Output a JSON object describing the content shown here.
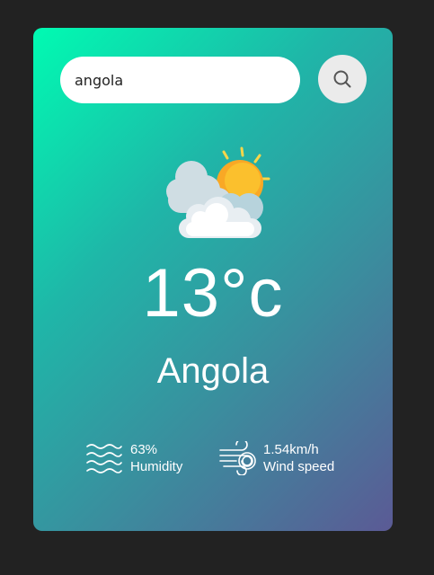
{
  "search": {
    "value": "angola",
    "placeholder": "",
    "button_icon": "search-icon"
  },
  "weather": {
    "icon": "partly-cloudy-icon",
    "temperature": "13°c",
    "city": "Angola"
  },
  "details": {
    "humidity": {
      "icon": "humidity-waves-icon",
      "value": "63%",
      "label": "Humidity"
    },
    "wind": {
      "icon": "wind-icon",
      "value": "1.54km/h",
      "label": "Wind speed"
    }
  },
  "colors": {
    "page_background": "#222222",
    "card_gradient_start": "#00fbb2",
    "card_gradient_end": "#5b5a95",
    "text": "#ffffff",
    "sun": "#f9a825",
    "cloud": "#e8eef2"
  }
}
